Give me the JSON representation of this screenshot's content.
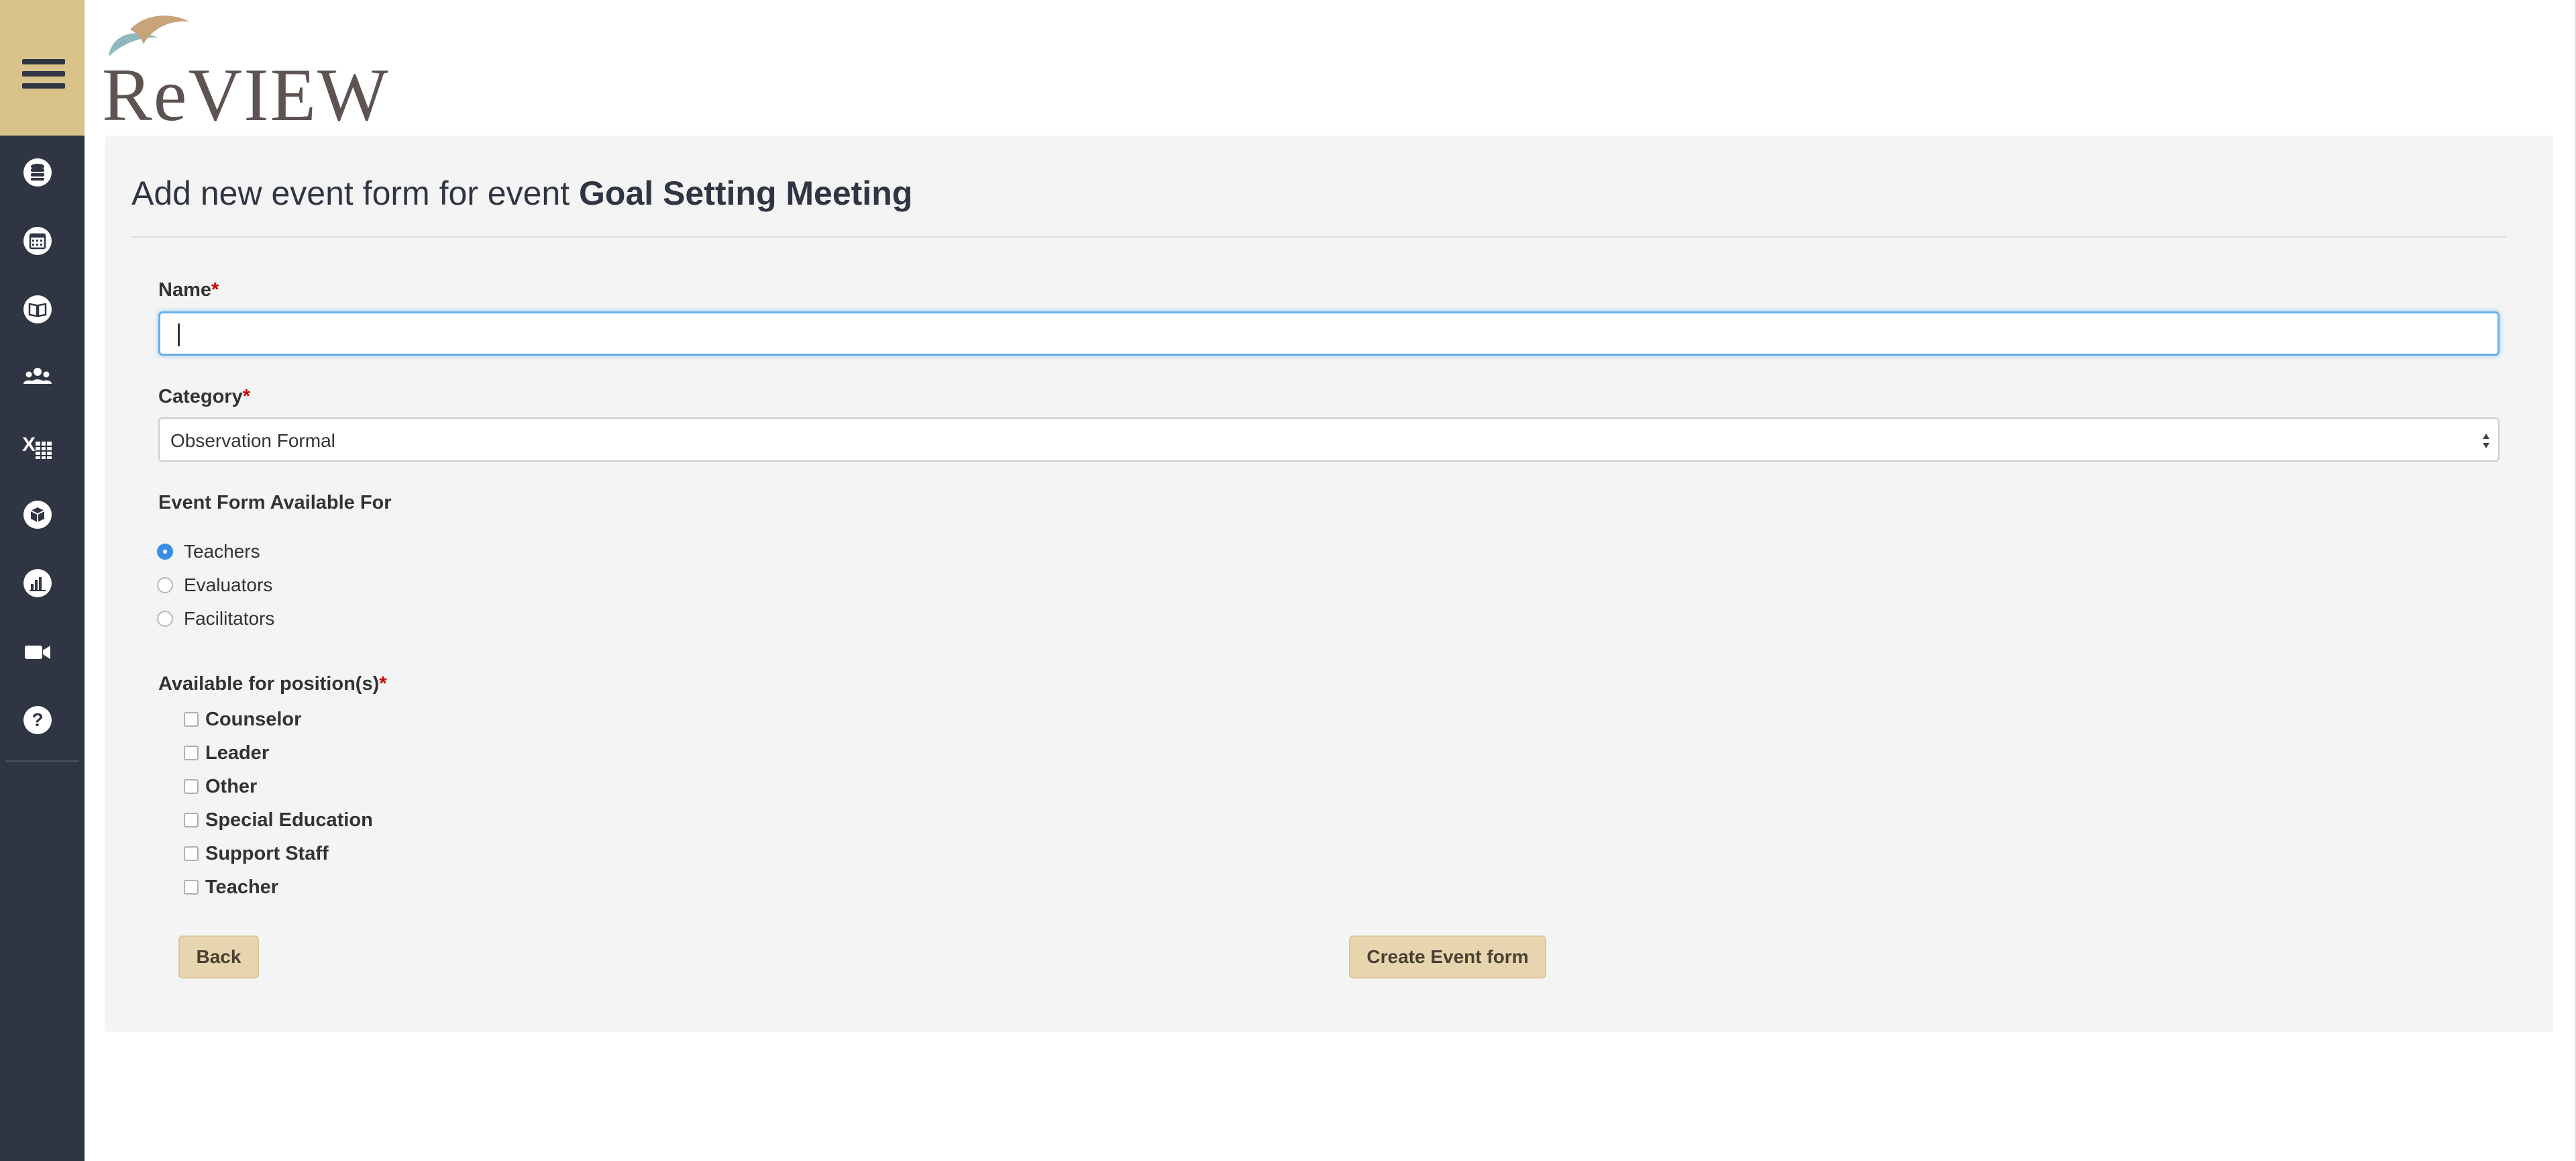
{
  "app": {
    "logo_text": "ReVIEW"
  },
  "sidebar": {
    "items": [
      {
        "icon": "database-icon"
      },
      {
        "icon": "calendar-icon"
      },
      {
        "icon": "book-icon"
      },
      {
        "icon": "users-icon"
      },
      {
        "icon": "spreadsheet-icon"
      },
      {
        "icon": "cube-icon"
      },
      {
        "icon": "bar-chart-icon"
      },
      {
        "icon": "video-camera-icon"
      },
      {
        "icon": "help-icon"
      }
    ]
  },
  "form": {
    "title_prefix": "Add new event form for event",
    "event_name": "Goal Setting Meeting",
    "name_label": "Name",
    "required_mark": "*",
    "name_value": "",
    "category_label": "Category",
    "category_value": "Observation Formal",
    "available_for_label": "Event Form Available For",
    "available_for_options": [
      {
        "label": "Teachers",
        "checked": true
      },
      {
        "label": "Evaluators",
        "checked": false
      },
      {
        "label": "Facilitators",
        "checked": false
      }
    ],
    "positions_label": "Available for position(s)",
    "positions": [
      {
        "label": "Counselor",
        "checked": false
      },
      {
        "label": "Leader",
        "checked": false
      },
      {
        "label": "Other",
        "checked": false
      },
      {
        "label": "Special Education",
        "checked": false
      },
      {
        "label": "Support Staff",
        "checked": false
      },
      {
        "label": "Teacher",
        "checked": false
      }
    ],
    "back_label": "Back",
    "create_label": "Create Event form"
  },
  "colors": {
    "sidebar_bg": "#2f3542",
    "sidebar_accent": "#d9c38b",
    "button_bg": "#e6d5ae",
    "focus_border": "#66afe9",
    "radio_checked": "#3b8ee8"
  }
}
